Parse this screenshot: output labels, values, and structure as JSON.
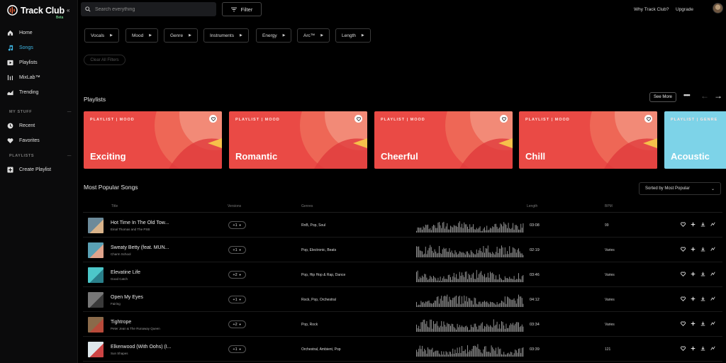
{
  "brand": {
    "name": "Track Club",
    "badge": "Beta"
  },
  "nav": [
    {
      "label": "Home",
      "icon": "home-icon",
      "active": false
    },
    {
      "label": "Songs",
      "icon": "music-note-icon",
      "active": true
    },
    {
      "label": "Playlists",
      "icon": "playlist-icon",
      "active": false
    },
    {
      "label": "MixLab™",
      "icon": "mixer-icon",
      "active": false
    },
    {
      "label": "Trending",
      "icon": "trending-icon",
      "active": false
    }
  ],
  "my_stuff": {
    "title": "MY STUFF",
    "items": [
      {
        "label": "Recent",
        "icon": "clock-icon"
      },
      {
        "label": "Favorites",
        "icon": "heart-icon"
      }
    ]
  },
  "playlists_section": {
    "title": "PLAYLISTS",
    "create_label": "Create Playlist"
  },
  "search": {
    "placeholder": "Search everything"
  },
  "filter_label": "Filter",
  "top_links": {
    "why": "Why Track Club?",
    "upgrade": "Upgrade"
  },
  "chips": [
    "Vocals",
    "Mood",
    "Genre",
    "Instruments",
    "Energy",
    "Arc™",
    "Length"
  ],
  "clear_label": "Clear All Filters",
  "playlists": {
    "title": "Playlists",
    "see_more": "See More",
    "cards": [
      {
        "tag": "PLAYLIST | MOOD",
        "name": "Exciting"
      },
      {
        "tag": "PLAYLIST | MOOD",
        "name": "Romantic"
      },
      {
        "tag": "PLAYLIST | MOOD",
        "name": "Cheerful"
      },
      {
        "tag": "PLAYLIST | MOOD",
        "name": "Chill"
      },
      {
        "tag": "PLAYLIST | GENRE",
        "name": "Acoustic"
      }
    ]
  },
  "songs": {
    "title": "Most Popular Songs",
    "sort_label": "Sorted by Most Popular",
    "columns": {
      "title": "Title",
      "versions": "Versions",
      "genres": "Genres",
      "length": "Length",
      "bpm": "BPM"
    },
    "rows": [
      {
        "title": "Hot Time In The Old Tow...",
        "artist": "Einal Thomas and The PSB",
        "versions": "+1",
        "genres": "RnB, Pop, Soul",
        "length": "03:08",
        "bpm": "99",
        "thumb": [
          "#6c8a9a",
          "#d9b38a"
        ]
      },
      {
        "title": "Sweaty Betty (feat. MUN...",
        "artist": "Charm School",
        "versions": "+1",
        "genres": "Pop, Electronic, Beats",
        "length": "02:19",
        "bpm": "Varies",
        "thumb": [
          "#5aa0b4",
          "#e0a48c"
        ]
      },
      {
        "title": "Elevatine Life",
        "artist": "Good Catch",
        "versions": "+2",
        "genres": "Pop, Hip Hop & Rap, Dance",
        "length": "03:46",
        "bpm": "Varies",
        "thumb": [
          "#4cc7c9",
          "#2a7f8a"
        ]
      },
      {
        "title": "Open My Eyes",
        "artist": "Fairing",
        "versions": "+1",
        "genres": "Rock, Pop, Orchestral",
        "length": "04:12",
        "bpm": "Varies",
        "thumb": [
          "#777",
          "#3a3a3a"
        ]
      },
      {
        "title": "Tightrope",
        "artist": "Peter Jean & The Runaway Queen",
        "versions": "+2",
        "genres": "Pop, Rock",
        "length": "03:34",
        "bpm": "Varies",
        "thumb": [
          "#8a6a4a",
          "#b84a3a"
        ]
      },
      {
        "title": "Elkenwood (With Oohs) (I...",
        "artist": "Sun Shapes",
        "versions": "+1",
        "genres": "Orchestral, Ambient, Pop",
        "length": "03:39",
        "bpm": "121",
        "thumb": [
          "#dde6ea",
          "#c44"
        ]
      }
    ]
  },
  "colors": {
    "accent": "#3fb8e6",
    "card_red": "#ea4a45",
    "card_blue": "#7dd3e8"
  }
}
